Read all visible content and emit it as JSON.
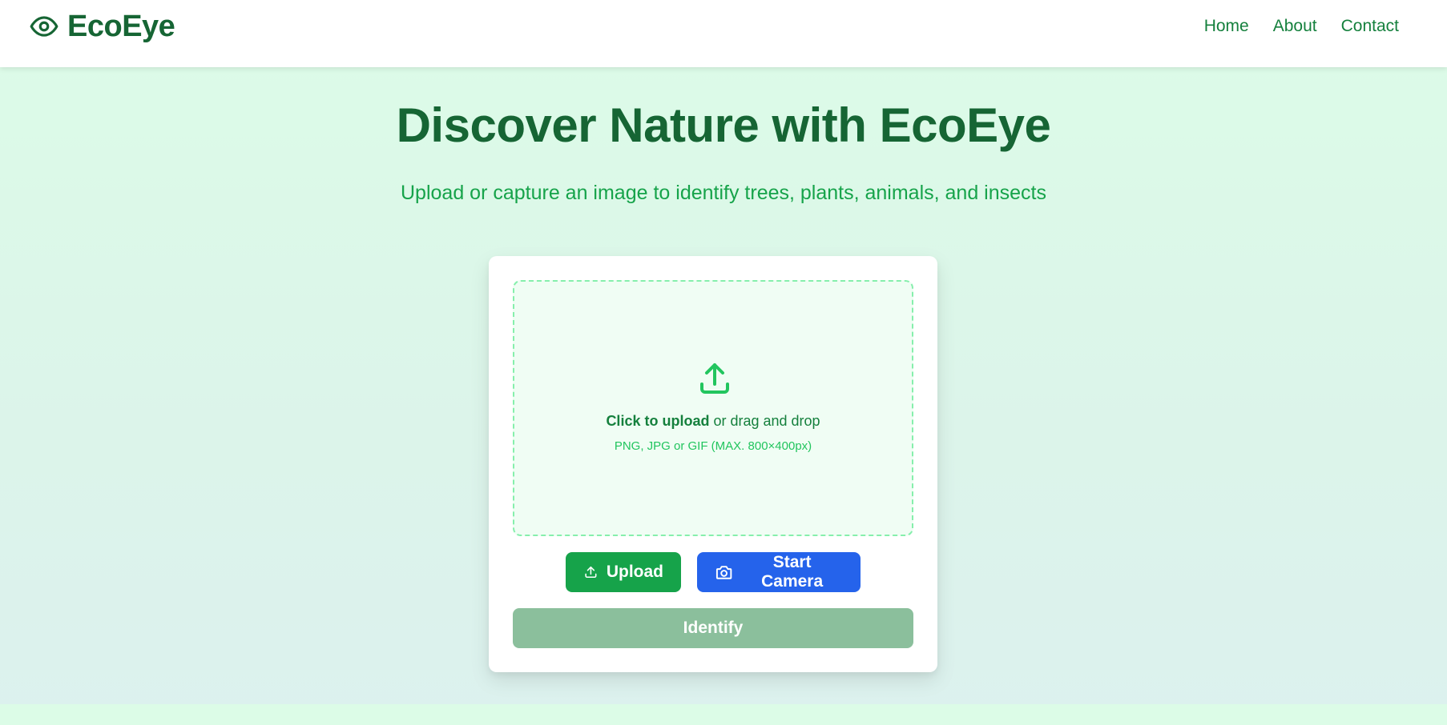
{
  "brand": {
    "name": "EcoEye",
    "icon": "eye-icon"
  },
  "nav": {
    "links": [
      "Home",
      "About",
      "Contact"
    ]
  },
  "hero": {
    "title": "Discover Nature with EcoEye",
    "subtitle": "Upload or capture an image to identify trees, plants, animals, and insects"
  },
  "dropzone": {
    "icon": "upload-arrow-icon",
    "action_bold": "Click to upload",
    "action_rest": " or drag and drop",
    "hint": "PNG, JPG or GIF (MAX. 800×400px)"
  },
  "buttons": {
    "upload": {
      "label": "Upload",
      "icon": "upload-icon",
      "color": "#16a34a"
    },
    "camera": {
      "label": "Start Camera",
      "icon": "camera-icon",
      "color": "#2563eb"
    },
    "identify": {
      "label": "Identify",
      "color": "#8bbf9c",
      "disabled": true
    }
  },
  "colors": {
    "brand_dark": "#166534",
    "accent_green": "#16a34a",
    "background": "#dcfce7"
  }
}
